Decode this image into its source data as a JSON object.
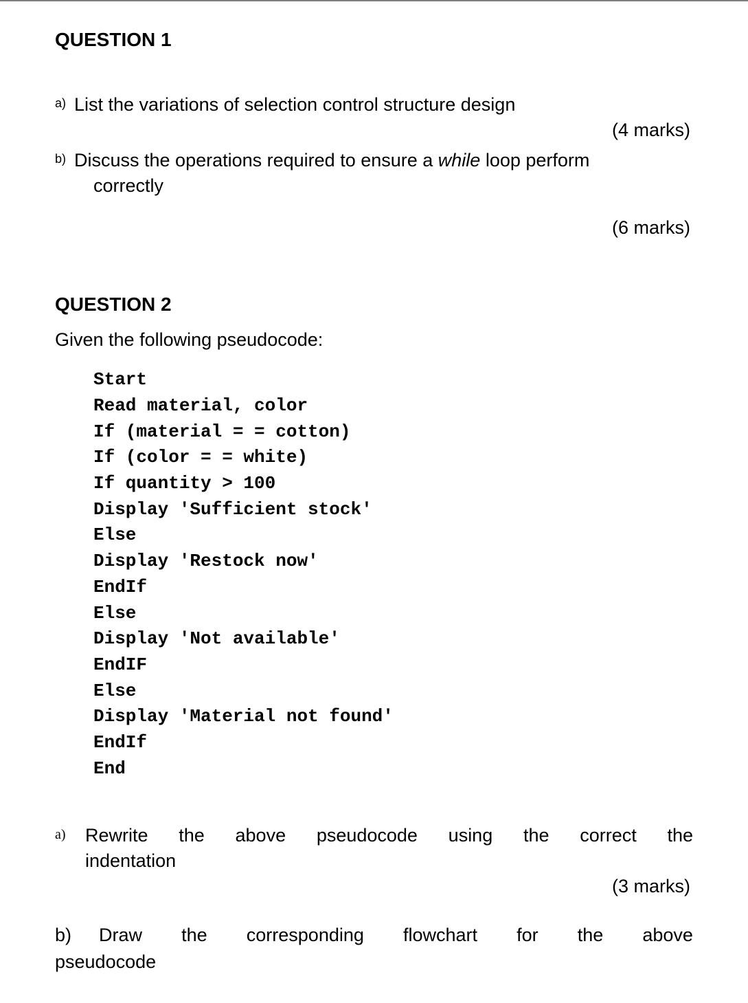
{
  "q1": {
    "heading": "QUESTION 1",
    "a": {
      "label": "a)",
      "text": "List the variations of selection control structure design",
      "marks": "(4 marks)"
    },
    "b": {
      "label": "b)",
      "text_pre": "Discuss the operations required to ensure a ",
      "text_italic": "while",
      "text_post": " loop perform",
      "text_line2": "correctly",
      "marks": "(6 marks)"
    }
  },
  "q2": {
    "heading": "QUESTION 2",
    "intro": "Given the following pseudocode:",
    "code": "Start\nRead material, color\nIf (material = = cotton)\nIf (color = = white)\nIf quantity > 100\nDisplay 'Sufficient stock'\nElse\nDisplay 'Restock now'\nEndIf\nElse\nDisplay 'Not available'\nEndIF\nElse\nDisplay 'Material not found'\nEndIf\nEnd",
    "a": {
      "label": "a)",
      "line1_words": [
        "Rewrite",
        "the",
        "above",
        "pseudocode",
        "using",
        "the",
        "correct",
        "the"
      ],
      "line2": "indentation",
      "marks": "(3 marks)"
    },
    "b": {
      "label": "b)",
      "line1_words": [
        "Draw",
        "the",
        "corresponding",
        "flowchart",
        "for",
        "the",
        "above"
      ],
      "line2": "pseudocode"
    }
  }
}
